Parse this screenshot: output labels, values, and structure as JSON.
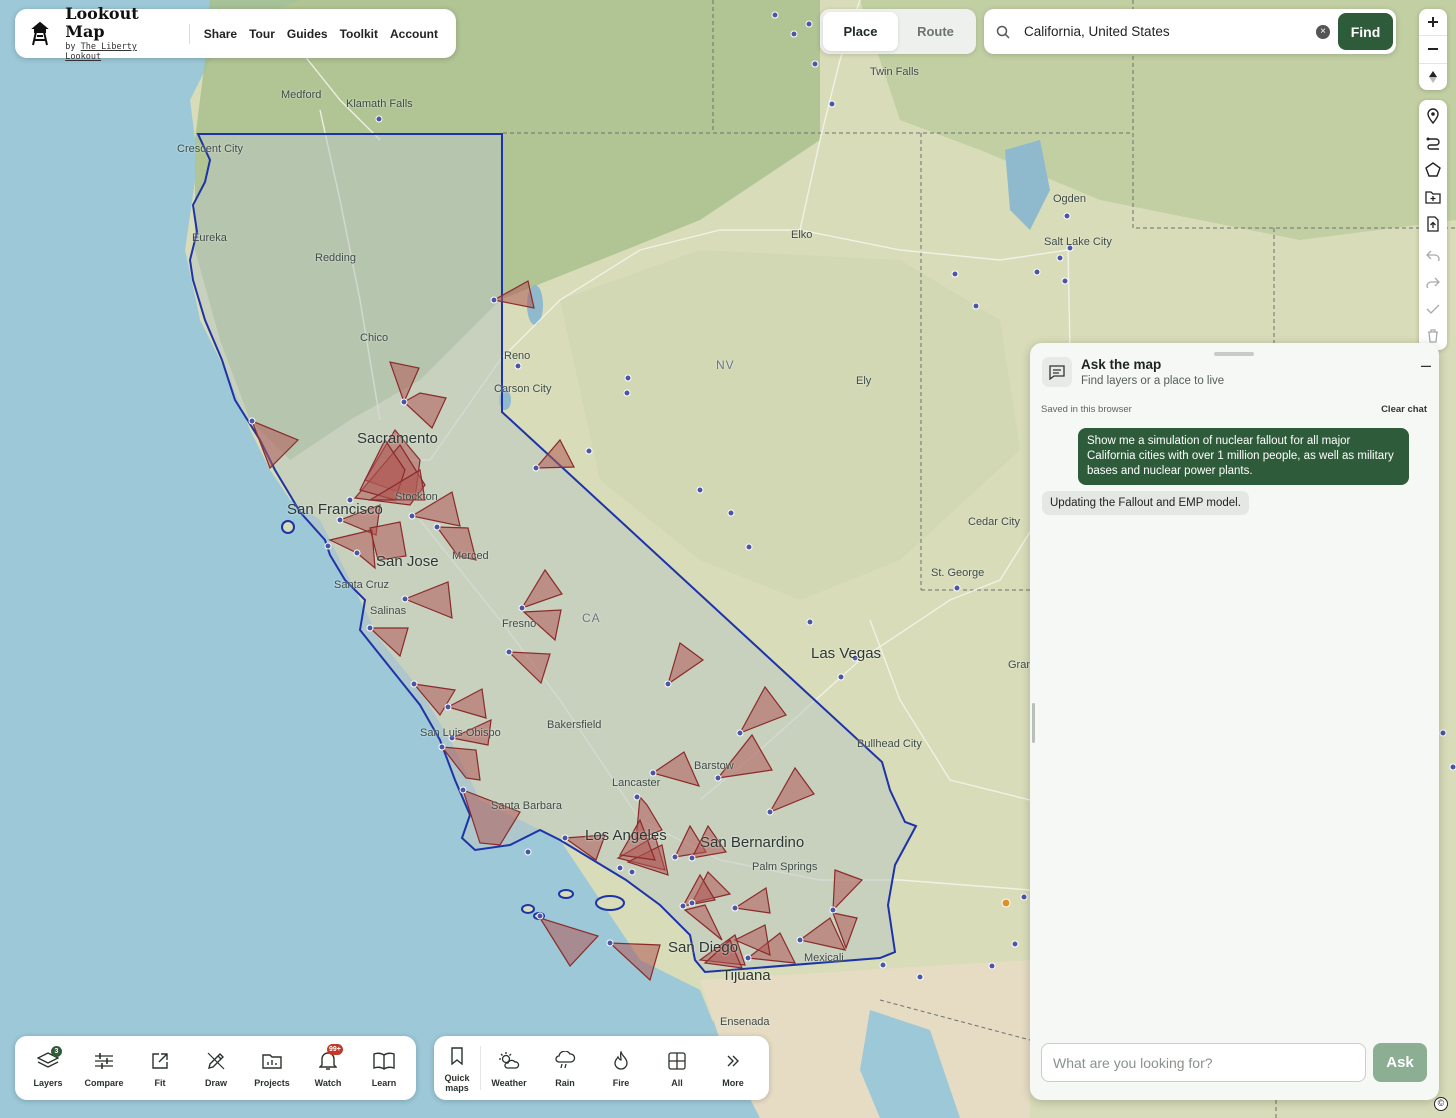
{
  "brand": {
    "title": "Lookout Map",
    "by": "by",
    "by_name": "The Liberty Lookout"
  },
  "nav": [
    "Share",
    "Tour",
    "Guides",
    "Toolkit",
    "Account"
  ],
  "mode": {
    "place": "Place",
    "route": "Route",
    "active": "place"
  },
  "search": {
    "value": "California, United States",
    "find_label": "Find"
  },
  "map_labels": {
    "cities": [
      "Twin Falls",
      "Medford",
      "Klamath Falls",
      "Crescent City",
      "Eureka",
      "Redding",
      "Chico",
      "Reno",
      "Carson City",
      "Elko",
      "Ogden",
      "Salt Lake City",
      "Ely",
      "Sacramento",
      "San Francisco",
      "San Jose",
      "Merced",
      "Santa Cruz",
      "Salinas",
      "Fresno",
      "Cedar City",
      "St. George",
      "Las Vegas",
      "Bakersfield",
      "San Luis Obispo",
      "Santa Barbara",
      "Lancaster",
      "Barstow",
      "Los Angeles",
      "San Bernardino",
      "Palm Springs",
      "Bullhead City",
      "San Diego",
      "Mexicali",
      "Tijuana",
      "Ensenada",
      "Gran",
      "Stockton"
    ],
    "states": [
      "NV",
      "CA"
    ]
  },
  "chat": {
    "title": "Ask the map",
    "subtitle": "Find layers or a place to live",
    "saved_note": "Saved in this browser",
    "clear_label": "Clear chat",
    "user_message": "Show me a simulation of nuclear fallout for all major California cities with over 1 million people, as well as military bases and nuclear power plants.",
    "bot_message": "Updating the Fallout and EMP model.",
    "input_placeholder": "What are you looking for?",
    "ask_label": "Ask"
  },
  "bottom_left": [
    {
      "label": "Layers",
      "icon": "layers-icon",
      "badge": "3"
    },
    {
      "label": "Compare",
      "icon": "sliders-icon"
    },
    {
      "label": "Fit",
      "icon": "fit-icon"
    },
    {
      "label": "Draw",
      "icon": "pencil-icon"
    },
    {
      "label": "Projects",
      "icon": "folder-icon"
    },
    {
      "label": "Watch",
      "icon": "bell-icon",
      "badge": "99+"
    },
    {
      "label": "Learn",
      "icon": "book-icon"
    }
  ],
  "bottom_right": [
    {
      "label": "Quick maps",
      "icon": "bookmark-icon"
    },
    {
      "label": "Weather",
      "icon": "sun-cloud-icon"
    },
    {
      "label": "Rain",
      "icon": "rain-icon"
    },
    {
      "label": "Fire",
      "icon": "flame-icon"
    },
    {
      "label": "All",
      "icon": "grid-icon"
    },
    {
      "label": "More",
      "icon": "chevrons-right-icon"
    }
  ],
  "colors": {
    "accent": "#2e5b3a",
    "ask_button": "#8cae93",
    "fallout": "#9c3b3b",
    "boundary": "#1d33a8",
    "water": "#9cc8d8"
  }
}
